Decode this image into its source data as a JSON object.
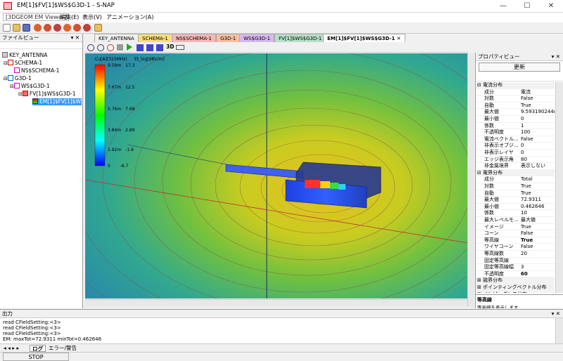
{
  "window": {
    "title": "EM[1]$FV[1]$WS$G3D-1 - S-NAP",
    "minimize": "—",
    "maximize": "☐",
    "close": "✕"
  },
  "menu": {
    "app": "[3DGEOM EM Viewer]",
    "items": [
      "編集(E)",
      "表示(V)",
      "アニメーション(A)"
    ]
  },
  "file_panel": {
    "title": "ファイルビュー",
    "tree": [
      {
        "label": "KEY_ANTENNA",
        "level": 0
      },
      {
        "label": "SCHEMA-1",
        "level": 1
      },
      {
        "label": "NS$SCHEMA-1",
        "level": 2
      },
      {
        "label": "G3D-1",
        "level": 1
      },
      {
        "label": "WS$G3D-1",
        "level": 2
      },
      {
        "label": "FV[1]$WS$G3D-1",
        "level": 3
      },
      {
        "label": "EM[1]$FV[1]$WS$",
        "level": 4,
        "selected": true
      }
    ]
  },
  "tabs": [
    {
      "label": "KEY_ANTENNA",
      "color": "#f0f0f0"
    },
    {
      "label": "SCHEMA-1",
      "color": "#f7e07a"
    },
    {
      "label": "NS$SCHEMA-1",
      "color": "#f5b8b8"
    },
    {
      "label": "G3D-1",
      "color": "#f7c0a0"
    },
    {
      "label": "WS$G3D-1",
      "color": "#d8b8f0"
    },
    {
      "label": "FV[1]$WS$G3D-1",
      "color": "#b8e0c8"
    },
    {
      "label": "EM[1]$FV[1]$WS$G3D-1",
      "color": "#ffffff",
      "active": true
    }
  ],
  "view_toolbar": {
    "label_3d": "3D"
  },
  "legend": {
    "header_left": "Cu[A](315MHz)",
    "header_right": "Et_log[dBV/m]",
    "rows": [
      {
        "left": "9.59m",
        "right": "17.3"
      },
      {
        "left": "7.67m",
        "right": "12.5"
      },
      {
        "left": "5.76m",
        "right": "7.68"
      },
      {
        "left": "3.84m",
        "right": "2.89"
      },
      {
        "left": "1.92m",
        "right": "-1.9"
      },
      {
        "left": "0",
        "right": "-6.7"
      }
    ]
  },
  "property_panel": {
    "title": "プロパティビュー",
    "refresh_button": "更新",
    "sections": [
      {
        "name": "電流分布",
        "rows": [
          {
            "key": "成分",
            "value": "電流"
          },
          {
            "key": "対数",
            "value": "False"
          },
          {
            "key": "自動",
            "value": "True"
          },
          {
            "key": "最大値",
            "value": "9.593190244m"
          },
          {
            "key": "最小値",
            "value": "0"
          },
          {
            "key": "係数",
            "value": "1"
          },
          {
            "key": "不透明度",
            "value": "100"
          },
          {
            "key": "電流ベクトル...",
            "value": "False"
          },
          {
            "key": "非表示オブジ...",
            "value": "0"
          },
          {
            "key": "非表示レイヤ",
            "value": "0"
          },
          {
            "key": "エッジ表示角",
            "value": "80"
          },
          {
            "key": "非金属境界",
            "value": "表示しない"
          }
        ]
      },
      {
        "name": "電界分布",
        "rows": [
          {
            "key": "成分",
            "value": "Total"
          },
          {
            "key": "対数",
            "value": "True"
          },
          {
            "key": "自動",
            "value": "True"
          },
          {
            "key": "最大値",
            "value": "72.9311"
          },
          {
            "key": "最小値",
            "value": "0.462646"
          },
          {
            "key": "係数",
            "value": "10"
          },
          {
            "key": "最大レベルモ...",
            "value": "最大値"
          },
          {
            "key": "イメージ",
            "value": "True"
          },
          {
            "key": "コーン",
            "value": "False"
          },
          {
            "key": "等高線",
            "value": "True"
          },
          {
            "key": "ワイヤコーン",
            "value": "False"
          },
          {
            "key": "等高線数",
            "value": "20"
          },
          {
            "key": "固定等高線",
            "value": ""
          },
          {
            "key": "固定等高線幅",
            "value": "3"
          },
          {
            "key": "不透明度",
            "value": "60"
          }
        ]
      }
    ],
    "collapsed": [
      "磁界分布",
      "ポインティングベクトル分布",
      "インピーダンス分布"
    ],
    "description_title": "等高線",
    "description_text": "等高線を表示します"
  },
  "output": {
    "title": "出力",
    "lines": [
      "read CFieldSetting:<3>",
      "read CFieldSetting:<3>",
      "read CFieldSetting:<3>",
      "EM: maxTot=72.9311 minTot=0.462646"
    ]
  },
  "bottom_tabs": [
    "ログ",
    "エラー/警告"
  ],
  "status": {
    "text": "STOP"
  }
}
